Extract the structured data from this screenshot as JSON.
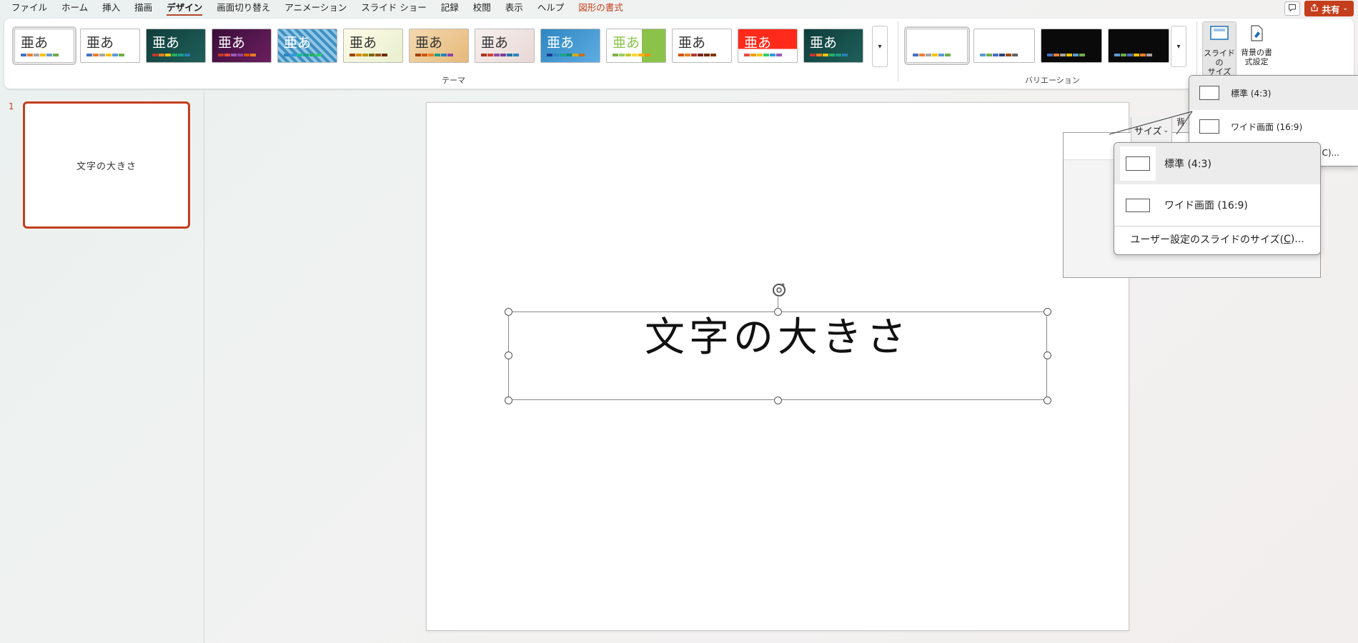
{
  "menu": {
    "tabs": [
      "ファイル",
      "ホーム",
      "挿入",
      "描画",
      "デザイン",
      "画面切り替え",
      "アニメーション",
      "スライド ショー",
      "記録",
      "校閲",
      "表示",
      "ヘルプ",
      "図形の書式"
    ],
    "active": "デザイン",
    "contextual": "図形の書式",
    "share_label": "共有"
  },
  "ribbon": {
    "themes_label": "テーマ",
    "variations_label": "バリエーション",
    "theme_glyph": "亜あ",
    "slide_size_label": "スライドの\nサイズ",
    "format_background_label": "背景の書\n式設定",
    "theme_swatches": [
      [
        "#4472c4",
        "#ed7d31",
        "#a5a5a5",
        "#ffc000",
        "#5b9bd5",
        "#70ad47"
      ],
      [
        "#4472c4",
        "#ed7d31",
        "#a5a5a5",
        "#ffc000",
        "#5b9bd5",
        "#70ad47"
      ],
      [
        "#c0392b",
        "#e67e22",
        "#f1c40f",
        "#27ae60",
        "#16a085",
        "#2980b9"
      ],
      [
        "#c0392b",
        "#e74c3c",
        "#9b59b6",
        "#8e44ad",
        "#d35400",
        "#e67e22"
      ],
      [
        "#2e86c1",
        "#3498db",
        "#1abc9c",
        "#16a085",
        "#27ae60",
        "#2ecc71"
      ],
      [
        "#a04000",
        "#d68910",
        "#b7950b",
        "#7d6608",
        "#935116",
        "#6e2c00"
      ],
      [
        "#a04000",
        "#d35400",
        "#e67e22",
        "#16a085",
        "#2980b9",
        "#8e44ad"
      ],
      [
        "#a93226",
        "#cb4335",
        "#884ea0",
        "#7d3c98",
        "#2471a3",
        "#2e86c1"
      ],
      [
        "#1f3a93",
        "#2e86c1",
        "#17a589",
        "#138d75",
        "#d4ac0d",
        "#ca6f1e"
      ],
      [
        "#7cb342",
        "#9ccc65",
        "#c0ca33",
        "#fdd835",
        "#ffb300",
        "#fb8c00"
      ],
      [
        "#d35400",
        "#e67e22",
        "#b03a2e",
        "#7b241c",
        "#6e2c00",
        "#873600"
      ],
      [
        "#e74c3c",
        "#f39c12",
        "#f1c40f",
        "#2ecc71",
        "#3498db",
        "#9b59b6"
      ],
      [
        "#c0392b",
        "#e67e22",
        "#f1c40f",
        "#27ae60",
        "#16a085",
        "#2980b9"
      ]
    ],
    "variation_swatches": [
      [
        "#4472c4",
        "#ed7d31",
        "#a5a5a5",
        "#ffc000",
        "#5b9bd5",
        "#70ad47"
      ],
      [
        "#5b9bd5",
        "#70ad47",
        "#4472c4",
        "#264478",
        "#9e480e",
        "#636363"
      ],
      [
        "#4472c4",
        "#ed7d31",
        "#a5a5a5",
        "#ffc000",
        "#5b9bd5",
        "#70ad47"
      ],
      [
        "#5b9bd5",
        "#70ad47",
        "#4472c4",
        "#ffc000",
        "#ed7d31",
        "#a5a5a5"
      ]
    ]
  },
  "thumbnails": [
    {
      "number": "1",
      "title": "文字の大きさ"
    }
  ],
  "slide": {
    "title": "文字の大きさ"
  },
  "ghost": {
    "size_button": "サイズ",
    "letter": "背"
  },
  "slide_size_menu": {
    "standard": "標準 (4:3)",
    "widescreen": "ワイド画面 (16:9)",
    "custom_prefix": "ユーザー設定のスライドのサイズ(",
    "custom_key": "C",
    "custom_suffix": ")...",
    "custom_truncated": "C)..."
  },
  "colors": {
    "accent": "#c43e1c",
    "share_bg": "#c43e1c"
  }
}
